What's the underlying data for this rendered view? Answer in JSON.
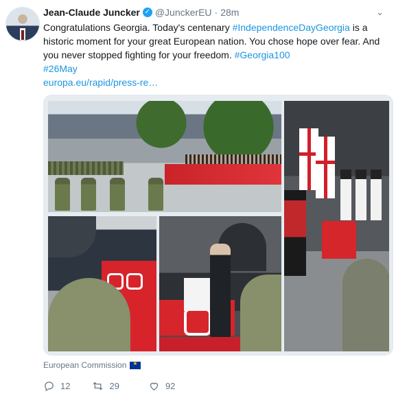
{
  "author": {
    "name": "Jean-Claude Juncker",
    "handle": "@JunckerEU",
    "separator": "·",
    "time": "28m"
  },
  "tweet": {
    "line_text1": "Congratulations Georgia. Today's centenary ",
    "hashtag1": "#IndependenceDayGeorgia",
    "line_text2": " is a historic moment for your great European nation. You chose hope over fear. And you never stopped fighting for your freedom. ",
    "hashtag2": "#Georgia100",
    "hashtag3": "#26May",
    "link": "europa.eu/rapid/press-re…"
  },
  "media": {
    "photos": [
      "parade",
      "flags",
      "crowd",
      "speaker"
    ]
  },
  "attribution": {
    "text": "European Commission"
  },
  "actions": {
    "replies": "12",
    "retweets": "29",
    "likes": "92"
  },
  "colors": {
    "link": "#1b95e0",
    "verified": "#1da1f2",
    "muted": "#657786"
  }
}
